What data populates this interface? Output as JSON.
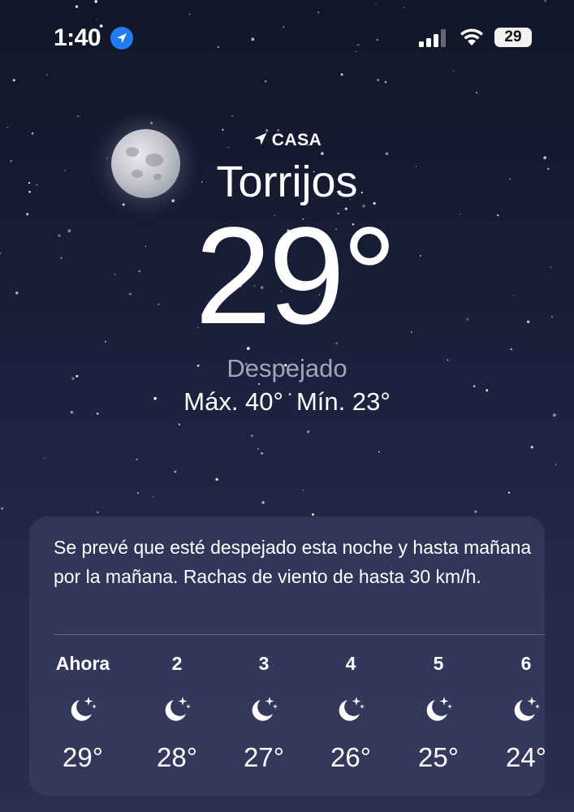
{
  "status_bar": {
    "time": "1:40",
    "battery": "29",
    "location_icon": "location-arrow-icon",
    "signal_icon": "cellular-signal-icon",
    "wifi_icon": "wifi-icon"
  },
  "location": {
    "tag": "CASA",
    "tag_icon": "location-arrow-icon",
    "city": "Torrijos",
    "temperature": "29°",
    "condition": "Despejado",
    "high": "Máx. 40°",
    "low": "Mín. 23°",
    "sky_icon": "moon-icon"
  },
  "forecast_card": {
    "summary": "Se prevé que esté despejado esta noche y hasta mañana por la mañana. Rachas de viento de hasta 30 km/h.",
    "hours": [
      {
        "label": "Ahora",
        "temp": "29°",
        "icon": "moon-stars-icon"
      },
      {
        "label": "2",
        "temp": "28°",
        "icon": "moon-stars-icon"
      },
      {
        "label": "3",
        "temp": "27°",
        "icon": "moon-stars-icon"
      },
      {
        "label": "4",
        "temp": "26°",
        "icon": "moon-stars-icon"
      },
      {
        "label": "5",
        "temp": "25°",
        "icon": "moon-stars-icon"
      },
      {
        "label": "6",
        "temp": "24°",
        "icon": "moon-stars-icon"
      }
    ]
  },
  "colors": {
    "background_top": "#121628",
    "background_bottom": "#2a2e4f",
    "location_badge": "#1f7cf5",
    "condition_text": "#a3a5bd"
  }
}
